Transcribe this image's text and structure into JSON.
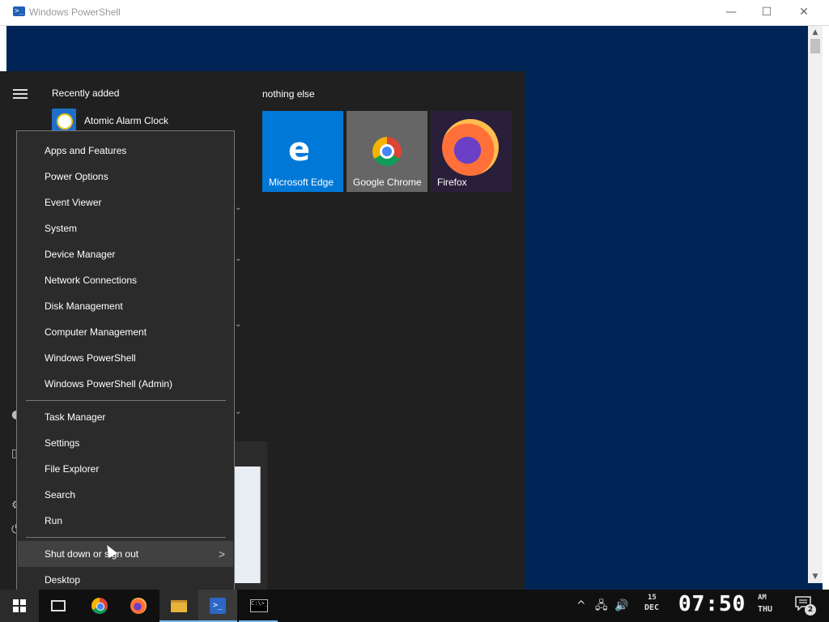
{
  "powershell_window": {
    "title": "Windows PowerShell",
    "controls": {
      "minimize": "—",
      "maximize": "☐",
      "close": "✕"
    },
    "scroll_up": "▲",
    "scroll_down": "▼"
  },
  "start_menu": {
    "recently_added_heading": "Recently added",
    "recent_app": "Atomic Alarm Clock",
    "tiles_group_heading": "nothing else",
    "tiles": [
      {
        "label": "Microsoft Edge",
        "color": "#0078d7"
      },
      {
        "label": "Google Chrome",
        "color": "#666666"
      },
      {
        "label": "Firefox",
        "color": "#2a1f3a"
      }
    ]
  },
  "context_menu": {
    "group1": [
      "Apps and Features",
      "Power Options",
      "Event Viewer",
      "System",
      "Device Manager",
      "Network Connections",
      "Disk Management",
      "Computer Management",
      "Windows PowerShell",
      "Windows PowerShell (Admin)"
    ],
    "group2": [
      "Task Manager",
      "Settings",
      "File Explorer",
      "Search",
      "Run"
    ],
    "group3": [
      "Shut down or sign out",
      "Desktop"
    ],
    "submenu_arrow": ">"
  },
  "taskbar": {
    "cmd_glyph": "C:\\>_",
    "ps_glyph": ">_",
    "tray": {
      "chevron": "^",
      "network": "🖧",
      "volume": "🔊"
    },
    "clock": {
      "day": "15",
      "month": "DEC",
      "time": "07:50",
      "ampm": "AM",
      "weekday": "THU"
    },
    "notification_count": "2"
  },
  "colors": {
    "powershell_bg": "#012456",
    "start_menu_bg": "#202020",
    "context_menu_bg": "#2b2b2b",
    "taskbar_bg": "#101010",
    "accent": "#76b9ed"
  }
}
